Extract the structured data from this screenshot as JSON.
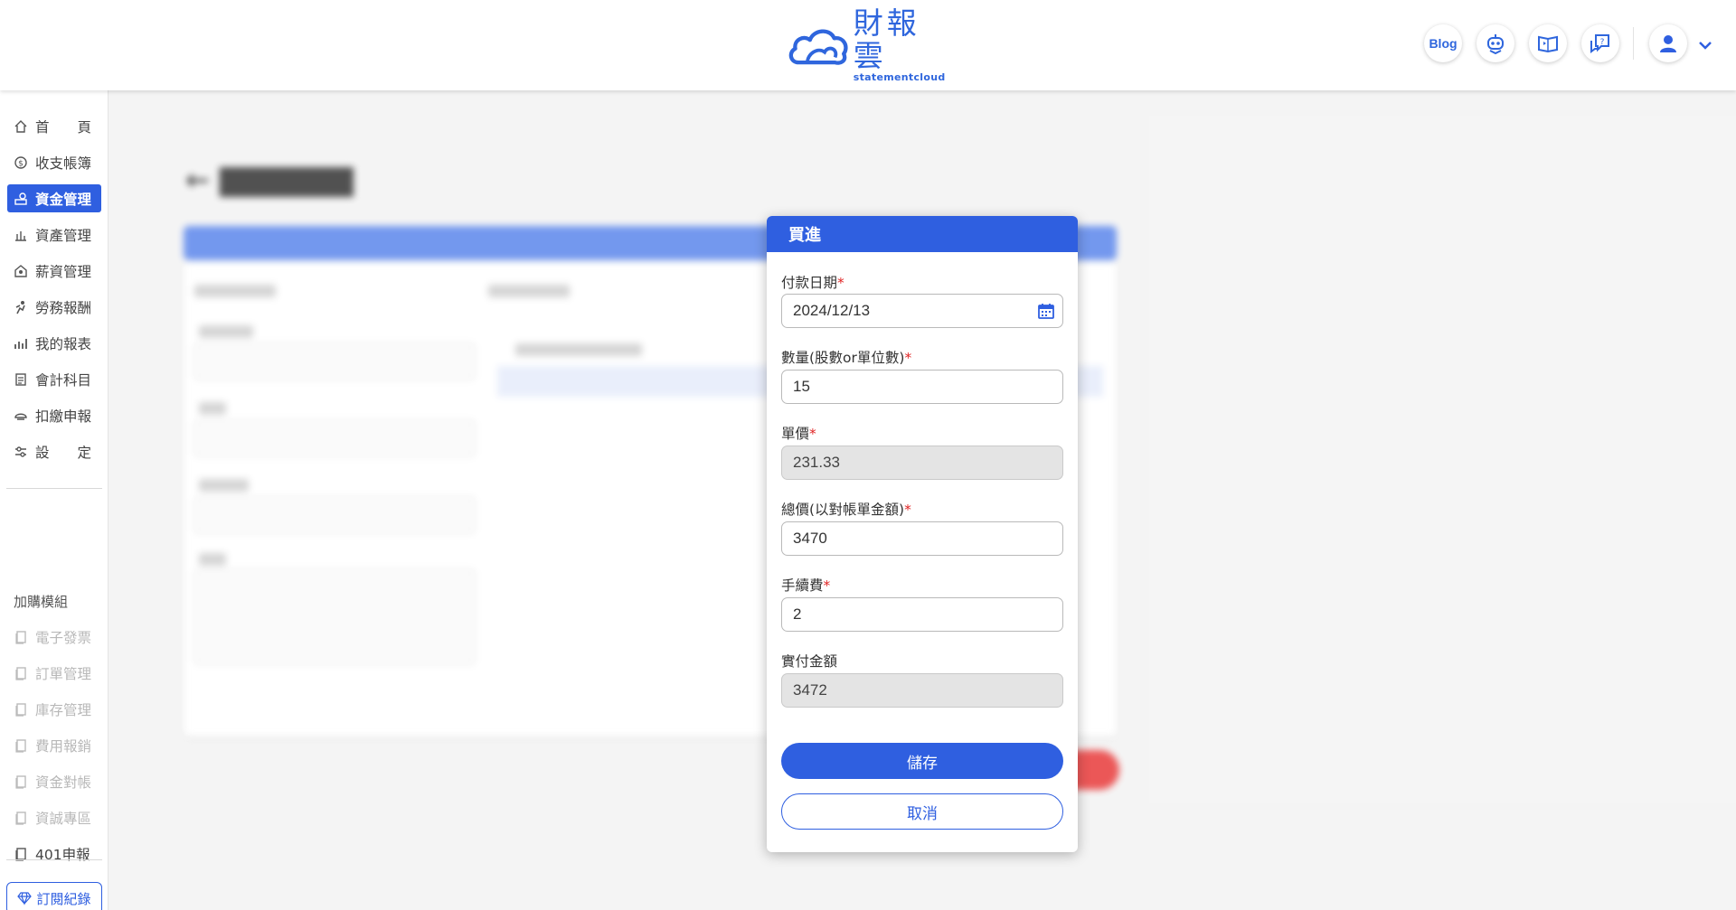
{
  "header": {
    "logo_main": "財報雲",
    "logo_sub": "statementcloud",
    "blog_label": "Blog",
    "icons": [
      "robot-icon",
      "video-book-icon",
      "help-chat-icon",
      "user-avatar-icon",
      "chevron-down-icon"
    ]
  },
  "sidebar": {
    "items": [
      {
        "label": "首頁",
        "icon": "home-icon"
      },
      {
        "label": "收支帳簿",
        "icon": "coin-icon"
      },
      {
        "label": "資金管理",
        "icon": "fund-icon"
      },
      {
        "label": "資產管理",
        "icon": "asset-icon"
      },
      {
        "label": "薪資管理",
        "icon": "payroll-icon"
      },
      {
        "label": "勞務報酬",
        "icon": "labor-icon"
      },
      {
        "label": "我的報表",
        "icon": "report-icon"
      },
      {
        "label": "會計科目",
        "icon": "ledger-icon"
      },
      {
        "label": "扣繳申報",
        "icon": "tax-icon"
      },
      {
        "label": "設定",
        "icon": "settings-icon"
      }
    ],
    "first_item": {
      "c1": "首",
      "c2": "頁"
    },
    "settings_item": {
      "c1": "設",
      "c2": "定"
    },
    "addon_title": "加購模組",
    "addons": [
      {
        "label": "電子發票"
      },
      {
        "label": "訂單管理"
      },
      {
        "label": "庫存管理"
      },
      {
        "label": "費用報銷"
      },
      {
        "label": "資金對帳"
      },
      {
        "label": "資誠專區"
      },
      {
        "label": "401申報"
      }
    ],
    "subscribe_label": "訂閱紀錄"
  },
  "modal": {
    "title": "買進",
    "fields": {
      "pay_date": {
        "label": "付款日期",
        "value": "2024/12/13"
      },
      "quantity": {
        "label": "數量(股數or單位數)",
        "value": "15"
      },
      "unit_price": {
        "label": "單價",
        "value": "231.33"
      },
      "total": {
        "label": "總價(以對帳單金額)",
        "value": "3470"
      },
      "fee": {
        "label": "手續費",
        "value": "2"
      },
      "paid": {
        "label": "實付金額",
        "value": "3472"
      }
    },
    "required_mark": "*",
    "save_label": "儲存",
    "cancel_label": "取消"
  },
  "colors": {
    "primary": "#2f5fe0",
    "danger": "#e83a3a",
    "required": "#e02424"
  }
}
